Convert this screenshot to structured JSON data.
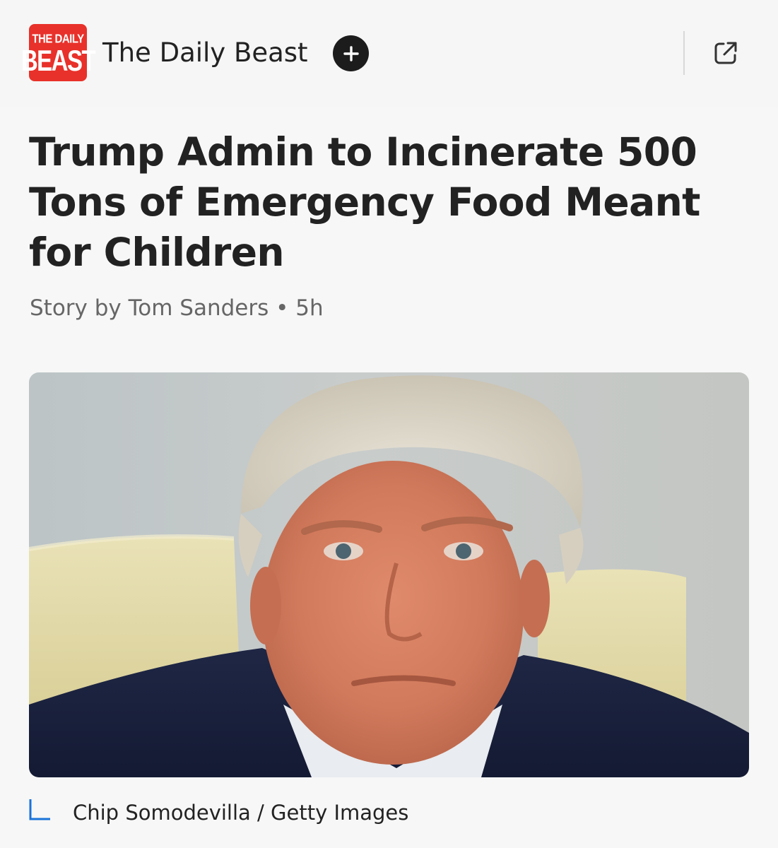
{
  "header": {
    "logo_line1": "THE DAILY",
    "logo_line2": "BEAST",
    "source_name": "The Daily Beast"
  },
  "article": {
    "headline": "Trump Admin to Incinerate 500 Tons of Emergency Food Meant for Children",
    "byline": "Story by Tom Sanders",
    "separator": "•",
    "time_ago": "5h",
    "photo_credit": "Chip Somodevilla / Getty Images"
  },
  "icons": {
    "follow": "plus-icon",
    "open": "external-link-icon",
    "caption": "corner-bracket-icon"
  },
  "colors": {
    "brand_red": "#e8312a",
    "accent_blue": "#1a73d9",
    "text_primary": "#222222",
    "text_secondary": "#666666"
  }
}
